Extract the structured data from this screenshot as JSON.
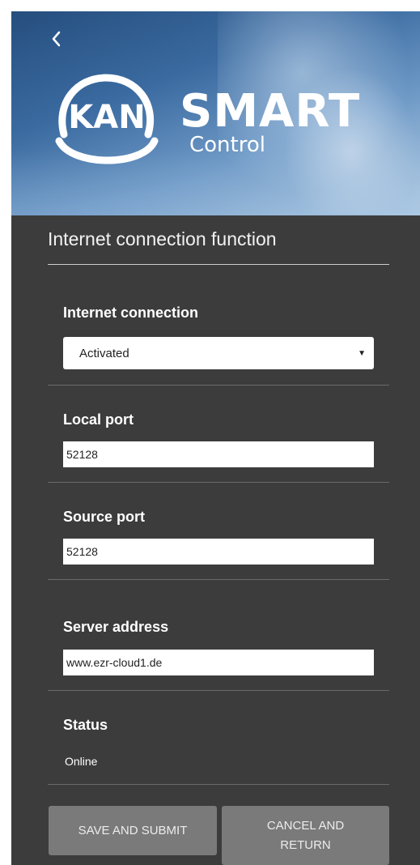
{
  "header": {
    "back_icon": "chevron-left-icon",
    "logo_text": "KAN",
    "brand_name": "SMART",
    "brand_sub": "Control"
  },
  "panel": {
    "title": "Internet connection function",
    "internet_connection": {
      "label": "Internet connection",
      "selected": "Activated"
    },
    "local_port": {
      "label": "Local port",
      "value": "52128"
    },
    "source_port": {
      "label": "Source port",
      "value": "52128"
    },
    "server_address": {
      "label": "Server address",
      "value": "www.ezr-cloud1.de"
    },
    "status": {
      "label": "Status",
      "value": "Online"
    }
  },
  "buttons": {
    "save_label": "SAVE AND SUBMIT",
    "cancel_label": "CANCEL AND RETURN"
  },
  "colors": {
    "panel_bg": "#3c3c3c",
    "button_bg": "#7a7a7a",
    "header_blue": "#3a6aa0"
  }
}
